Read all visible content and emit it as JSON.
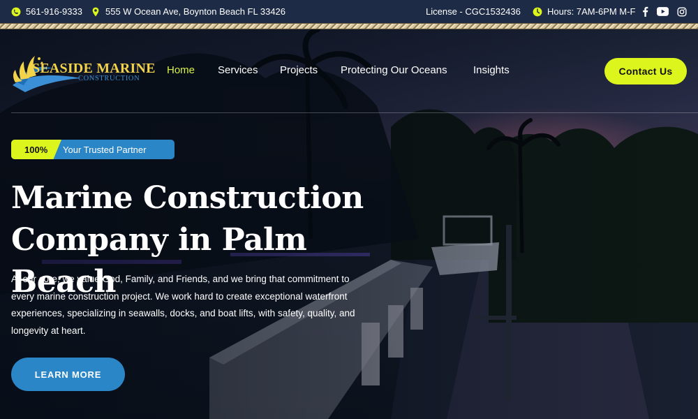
{
  "topbar": {
    "phone": "561-916-9333",
    "address": "555 W Ocean Ave, Boynton Beach FL 33426",
    "license": "License - CGC1532436",
    "hours": "Hours: 7AM-6PM M-F",
    "social_icons": [
      "facebook-icon",
      "youtube-icon",
      "instagram-icon"
    ]
  },
  "brand": {
    "name": "SEASIDE MARINE",
    "subtitle": "CONSTRUCTION",
    "colors": {
      "gold": "#f2d34a",
      "blue": "#3b8fd6"
    }
  },
  "nav": {
    "items": [
      {
        "label": "Home",
        "active": true
      },
      {
        "label": "Services",
        "active": false
      },
      {
        "label": "Projects",
        "active": false
      },
      {
        "label": "Protecting Our Oceans",
        "active": false
      },
      {
        "label": "Insights",
        "active": false
      }
    ],
    "contact_label": "Contact Us"
  },
  "hero": {
    "badge_percent": "100%",
    "badge_label": "Your Trusted Partner",
    "headline_line1": "Marine Construction",
    "headline_line2": "Company in Palm Beach",
    "lead": "At our core, we value God, Family, and Friends, and we bring that commitment to every marine construction project. We work hard to create exceptional waterfront experiences, specializing in seawalls, docks, and boat lifts, with safety, quality, and longevity at heart.",
    "cta_label": "LEARN MORE"
  },
  "theme": {
    "accent_lime": "#dcf51c",
    "accent_blue": "#2b86c8",
    "topbar_bg": "#1d2b46"
  }
}
